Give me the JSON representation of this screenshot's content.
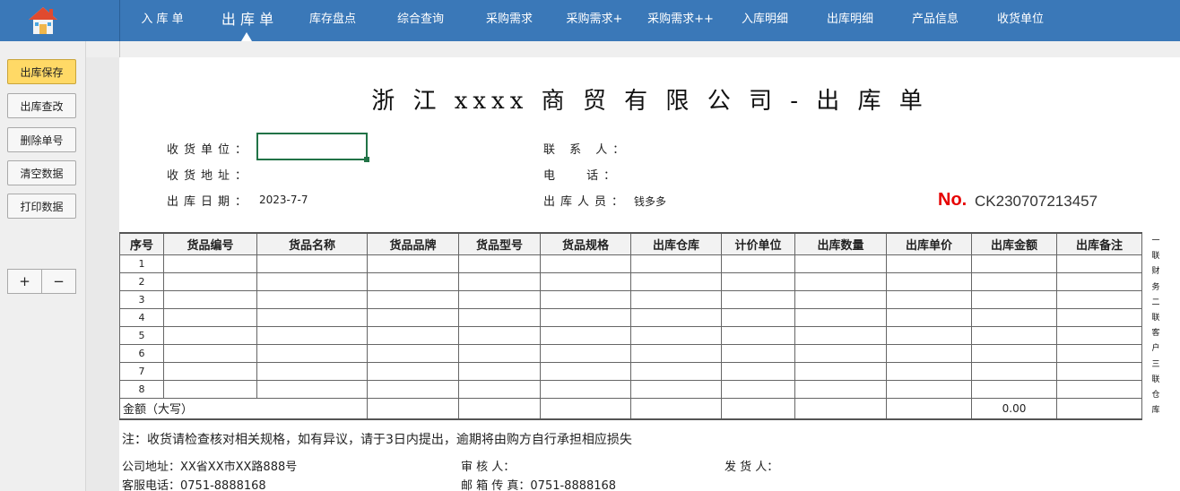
{
  "nav": {
    "items": [
      {
        "label": "入 库 单"
      },
      {
        "label": "出 库 单"
      },
      {
        "label": "库存盘点"
      },
      {
        "label": "综合查询"
      },
      {
        "label": "采购需求"
      },
      {
        "label": "采购需求+"
      },
      {
        "label": "采购需求++"
      },
      {
        "label": "入库明细"
      },
      {
        "label": "出库明细"
      },
      {
        "label": "产品信息"
      },
      {
        "label": "收货单位"
      }
    ],
    "active_index": 1
  },
  "sidebar": {
    "buttons": [
      {
        "label": "出库保存"
      },
      {
        "label": "出库查改"
      },
      {
        "label": "删除单号"
      },
      {
        "label": "清空数据"
      },
      {
        "label": "打印数据"
      }
    ],
    "plus": "+",
    "minus": "−"
  },
  "document": {
    "title": "浙 江 xxxx 商 贸 有 限 公 司 - 出 库 单",
    "fields": {
      "customer_label": "收货单位：",
      "customer_value": "",
      "address_label": "收货地址：",
      "date_label": "出库日期：",
      "date_value": "2023-7-7",
      "contact_label": "联 系 人：",
      "phone_label": "电　 话：",
      "operator_label": "出库人员：",
      "operator_value": "钱多多"
    },
    "no_label": "No.",
    "no_value": "CK230707213457"
  },
  "table": {
    "headers": [
      "序号",
      "货品编号",
      "货品名称",
      "货品品牌",
      "货品型号",
      "货品规格",
      "出库仓库",
      "计价单位",
      "出库数量",
      "出库单价",
      "出库金额",
      "出库备注"
    ],
    "rows": [
      "1",
      "2",
      "3",
      "4",
      "5",
      "6",
      "7",
      "8"
    ],
    "total_label": "金额（大写）",
    "total_amount": "0.00"
  },
  "side_copies": [
    "一",
    "联",
    "财",
    "务",
    "二",
    "联",
    "客",
    "户",
    "三",
    "联",
    "仓",
    "库"
  ],
  "note": "注：收货请检查核对相关规格，如有异议，请于3日内提出，逾期将由购方自行承担相应损失",
  "footer": {
    "company_address": "公司地址：XX省XX市XX路888号",
    "service_phone": "客服电话：0751-8888168",
    "reviewer": "审 核 人：",
    "mail_fax": "邮 箱 传 真：0751-8888168",
    "shipper": "发 货 人："
  },
  "colors": {
    "topbar": "#3a78b8",
    "primary_button": "#ffd966",
    "selected_cell": "#217346",
    "no_label": "#e60000"
  }
}
